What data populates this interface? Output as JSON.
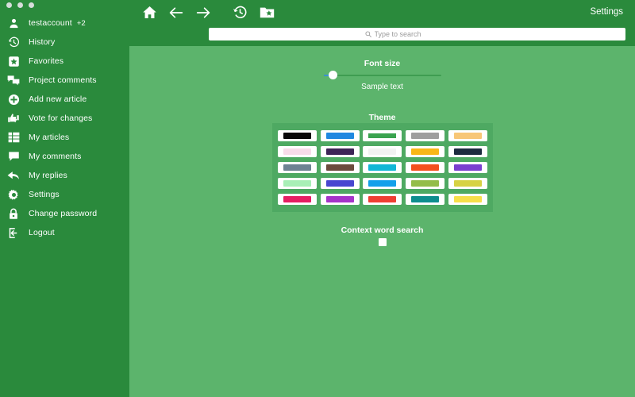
{
  "window": {
    "dots": [
      "close-dot",
      "minimize-dot",
      "maximize-dot"
    ]
  },
  "sidebar": {
    "account": {
      "name": "testaccount",
      "badge": "+2",
      "icon": "person-icon"
    },
    "items": [
      {
        "label": "History",
        "icon": "history-clock-icon"
      },
      {
        "label": "Favorites",
        "icon": "star-bookmark-icon"
      },
      {
        "label": "Project comments",
        "icon": "comments-icon"
      },
      {
        "label": "Add new article",
        "icon": "plus-circle-icon"
      },
      {
        "label": "Vote for changes",
        "icon": "thumbs-updown-icon"
      },
      {
        "label": "My articles",
        "icon": "list-grid-icon"
      },
      {
        "label": "My comments",
        "icon": "comment-bubble-icon"
      },
      {
        "label": "My replies",
        "icon": "reply-arrow-icon"
      },
      {
        "label": "Settings",
        "icon": "gear-icon"
      },
      {
        "label": "Change password",
        "icon": "lock-icon"
      },
      {
        "label": "Logout",
        "icon": "logout-icon"
      }
    ]
  },
  "header": {
    "nav": [
      {
        "name": "home-button",
        "icon": "home-icon"
      },
      {
        "name": "back-button",
        "icon": "arrow-left-icon"
      },
      {
        "name": "forward-button",
        "icon": "arrow-right-icon"
      },
      {
        "name": "history-button",
        "icon": "history-clock-icon"
      },
      {
        "name": "bookmarks-button",
        "icon": "folder-star-icon"
      }
    ],
    "settings_label": "Settings",
    "search": {
      "placeholder": "Type to search",
      "value": "",
      "icon": "search-icon"
    }
  },
  "main": {
    "font_size": {
      "title": "Font size",
      "slider_value": 6,
      "slider_min": 0,
      "slider_max": 100,
      "sample_text": "Sample text"
    },
    "theme": {
      "title": "Theme",
      "selected_index": 2,
      "swatches": [
        {
          "name": "theme-black",
          "color": "#080808"
        },
        {
          "name": "theme-blue",
          "color": "#2088e0"
        },
        {
          "name": "theme-green",
          "color": "#3aa34f"
        },
        {
          "name": "theme-gray",
          "color": "#9e9e9e"
        },
        {
          "name": "theme-tan",
          "color": "#f7c777"
        },
        {
          "name": "theme-pink",
          "color": "#f8dcea"
        },
        {
          "name": "theme-dark-purple",
          "color": "#3d2456"
        },
        {
          "name": "theme-white",
          "color": "#f2f2f2"
        },
        {
          "name": "theme-amber",
          "color": "#f9b717"
        },
        {
          "name": "theme-navy",
          "color": "#1d2b3f"
        },
        {
          "name": "theme-slate",
          "color": "#6d8292"
        },
        {
          "name": "theme-brown",
          "color": "#6b4a3c"
        },
        {
          "name": "theme-cyan",
          "color": "#12b6d6"
        },
        {
          "name": "theme-orange-red",
          "color": "#f4501e"
        },
        {
          "name": "theme-violet",
          "color": "#7a3fcf"
        },
        {
          "name": "theme-mint",
          "color": "#a8 efb6"
        },
        {
          "name": "theme-indigo",
          "color": "#4946d0"
        },
        {
          "name": "theme-sky",
          "color": "#14a0ea"
        },
        {
          "name": "theme-olive",
          "color": "#93bd49"
        },
        {
          "name": "theme-yellow-green",
          "color": "#d6d243"
        },
        {
          "name": "theme-magenta",
          "color": "#e61e62"
        },
        {
          "name": "theme-purple",
          "color": "#a534c9"
        },
        {
          "name": "theme-red",
          "color": "#ef3e33"
        },
        {
          "name": "theme-teal",
          "color": "#0e8e8e"
        },
        {
          "name": "theme-yellow",
          "color": "#f7df4a"
        }
      ]
    },
    "context_word_search": {
      "title": "Context word search",
      "checked": false
    }
  },
  "colors": {
    "sidebar_bg": "#2a8a3c",
    "header_bg": "#2a8a3c",
    "content_bg": "#5cb46c",
    "panel_bg": "#4ea962",
    "accent_blue": "#3b8fd6",
    "text_white": "#ffffff"
  }
}
